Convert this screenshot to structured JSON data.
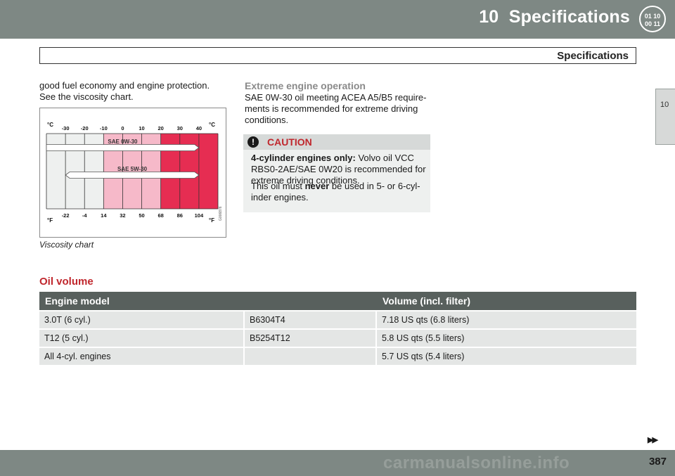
{
  "header": {
    "chapter_number": "10",
    "title": "Specifications",
    "badge_top": "01 10",
    "badge_bottom": "00 11"
  },
  "subtitle": "Specifications",
  "side_tab": "10",
  "intro_line1": "good fuel economy and engine protection.",
  "intro_line2": "See the viscosity chart.",
  "chart_caption": "Viscosity chart",
  "extreme": {
    "heading": "Extreme engine operation",
    "line1": "SAE 0W-30 oil meeting ACEA A5/B5 require-",
    "line2": "ments is recommended for extreme driving",
    "line3": "conditions."
  },
  "caution": {
    "title": "CAUTION",
    "bold_lead": "4-cylinder engines only:",
    "line1_rest": " Volvo oil VCC",
    "line2": "RBS0-2AE/SAE 0W20 is recommended for",
    "line3": "extreme driving conditions.",
    "p2_pre": "This oil must ",
    "p2_bold": "never",
    "p2_post": " be used in 5- or 6-cyl-",
    "p2_line2": "inder engines."
  },
  "oil_volume": {
    "heading": "Oil volume",
    "col_engine": "Engine model",
    "col_volume": "Volume (incl. filter)",
    "rows": [
      {
        "model": "3.0T (6 cyl.)",
        "code": "B6304T4",
        "volume": "7.18 US qts (6.8 liters)"
      },
      {
        "model": "T12 (5 cyl.)",
        "code": "B5254T12",
        "volume": "5.8 US qts (5.5 liters)"
      },
      {
        "model": "All 4-cyl. engines",
        "code": "",
        "volume": "5.7 US qts (5.4 liters)"
      }
    ]
  },
  "chart_data": {
    "type": "table",
    "unit_c": "°C",
    "unit_f": "°F",
    "c_ticks": [
      "-30",
      "-20",
      "-10",
      "0",
      "10",
      "20",
      "30",
      "40"
    ],
    "f_ticks": [
      "-22",
      "-4",
      "14",
      "32",
      "50",
      "68",
      "86",
      "104"
    ],
    "series": [
      {
        "name": "SAE 0W-30",
        "range_c": [
          -40,
          40
        ]
      },
      {
        "name": "SAE 5W-30",
        "range_c": [
          -30,
          40
        ]
      }
    ],
    "bands": [
      {
        "range_c": [
          -40,
          -10
        ],
        "color": "#eef0ef"
      },
      {
        "range_c": [
          -10,
          20
        ],
        "color": "#f6b9c9"
      },
      {
        "range_c": [
          20,
          50
        ],
        "color": "#e62d52"
      }
    ],
    "figure_code": "G006876"
  },
  "footer": {
    "page_number": "387",
    "next_arrow": "▶▶",
    "watermark": "carmanualsonline.info"
  },
  "colors": {
    "header": "#7e8884",
    "accent_red": "#c0272d",
    "table_header": "#58605d"
  }
}
